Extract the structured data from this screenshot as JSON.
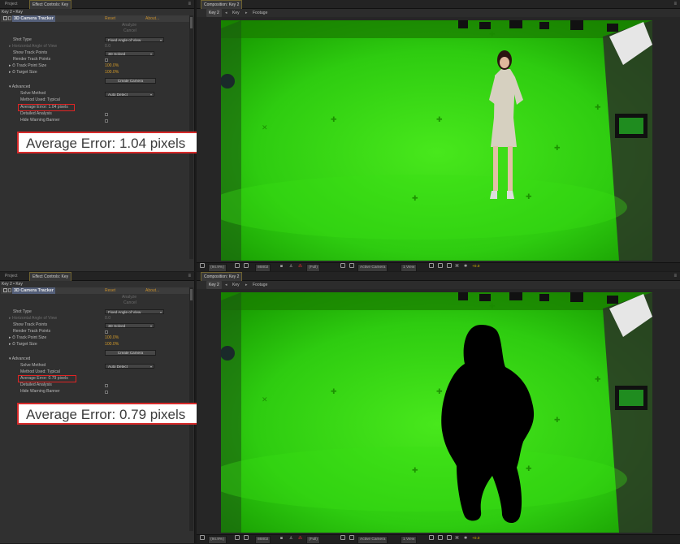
{
  "panels": [
    {
      "panel_tabs": {
        "project": "Project",
        "effect_controls": "Effect Controls: Key"
      },
      "comp_tab": "Composition: Key 2",
      "breadcrumb": {
        "current": "Key 2",
        "sep": "◂",
        "layer1": "Key",
        "arrow": "▸",
        "layer2": "Footage"
      },
      "layer_path": "Key 2 • Key",
      "effect": {
        "name": "3D Camera Tracker",
        "reset": "Reset",
        "about": "About..."
      },
      "status": [
        "Analyze",
        "Cancel"
      ],
      "shot_type": {
        "label": "Shot Type",
        "value": "Fixed Angle of View"
      },
      "hfov": {
        "label": "Horizontal Angle of View",
        "value": "0.0"
      },
      "show_track_points": {
        "label": "Show Track Points",
        "value": "3D Solved"
      },
      "render_track_points": {
        "label": "Render Track Points"
      },
      "track_point_size": {
        "label": "Track Point Size",
        "value": "100.0%"
      },
      "target_size": {
        "label": "Target Size",
        "value": "100.0%"
      },
      "create_camera": "Create Camera",
      "advanced": {
        "label": "Advanced",
        "solve_method": {
          "label": "Solve Method",
          "value": "Auto Detect"
        },
        "method_used": "Method Used: Typical",
        "average_error": "Average Error: 1.04 pixels",
        "detailed_analysis": "Detailed Analysis",
        "hide_warning": "Hide Warning Banner"
      },
      "callout": "Average Error: 1.04 pixels",
      "viewer_bar": {
        "zoom": "(94.9%)",
        "frame": "86802",
        "resolution": "(Full)",
        "camera": "Active Camera",
        "views": "1 View",
        "exposure": "+0.0"
      },
      "matte": false
    },
    {
      "panel_tabs": {
        "project": "Project",
        "effect_controls": "Effect Controls: Key"
      },
      "comp_tab": "Composition: Key 2",
      "breadcrumb": {
        "current": "Key 2",
        "sep": "◂",
        "layer1": "Key",
        "arrow": "▸",
        "layer2": "Footage"
      },
      "layer_path": "Key 2 • Key",
      "effect": {
        "name": "3D Camera Tracker",
        "reset": "Reset",
        "about": "About..."
      },
      "status": [
        "Analyze",
        "Cancel"
      ],
      "shot_type": {
        "label": "Shot Type",
        "value": "Fixed Angle of View"
      },
      "hfov": {
        "label": "Horizontal Angle of View",
        "value": "0.0"
      },
      "show_track_points": {
        "label": "Show Track Points",
        "value": "3D Solved"
      },
      "render_track_points": {
        "label": "Render Track Points"
      },
      "track_point_size": {
        "label": "Track Point Size",
        "value": "100.0%"
      },
      "target_size": {
        "label": "Target Size",
        "value": "100.0%"
      },
      "create_camera": "Create Camera",
      "advanced": {
        "label": "Advanced",
        "solve_method": {
          "label": "Solve Method",
          "value": "Auto Detect"
        },
        "method_used": "Method Used: Typical",
        "average_error": "Average Error: 0.79 pixels",
        "detailed_analysis": "Detailed Analysis",
        "hide_warning": "Hide Warning Banner"
      },
      "callout": "Average Error: 0.79 pixels",
      "viewer_bar": {
        "zoom": "(94.9%)",
        "frame": "86802",
        "resolution": "(Full)",
        "camera": "Active Camera",
        "views": "1 View",
        "exposure": "+0.0"
      },
      "matte": true
    }
  ],
  "colors": {
    "green_screen": "#22b400",
    "highlight": "#e02424",
    "value_orange": "#d29a2a"
  }
}
